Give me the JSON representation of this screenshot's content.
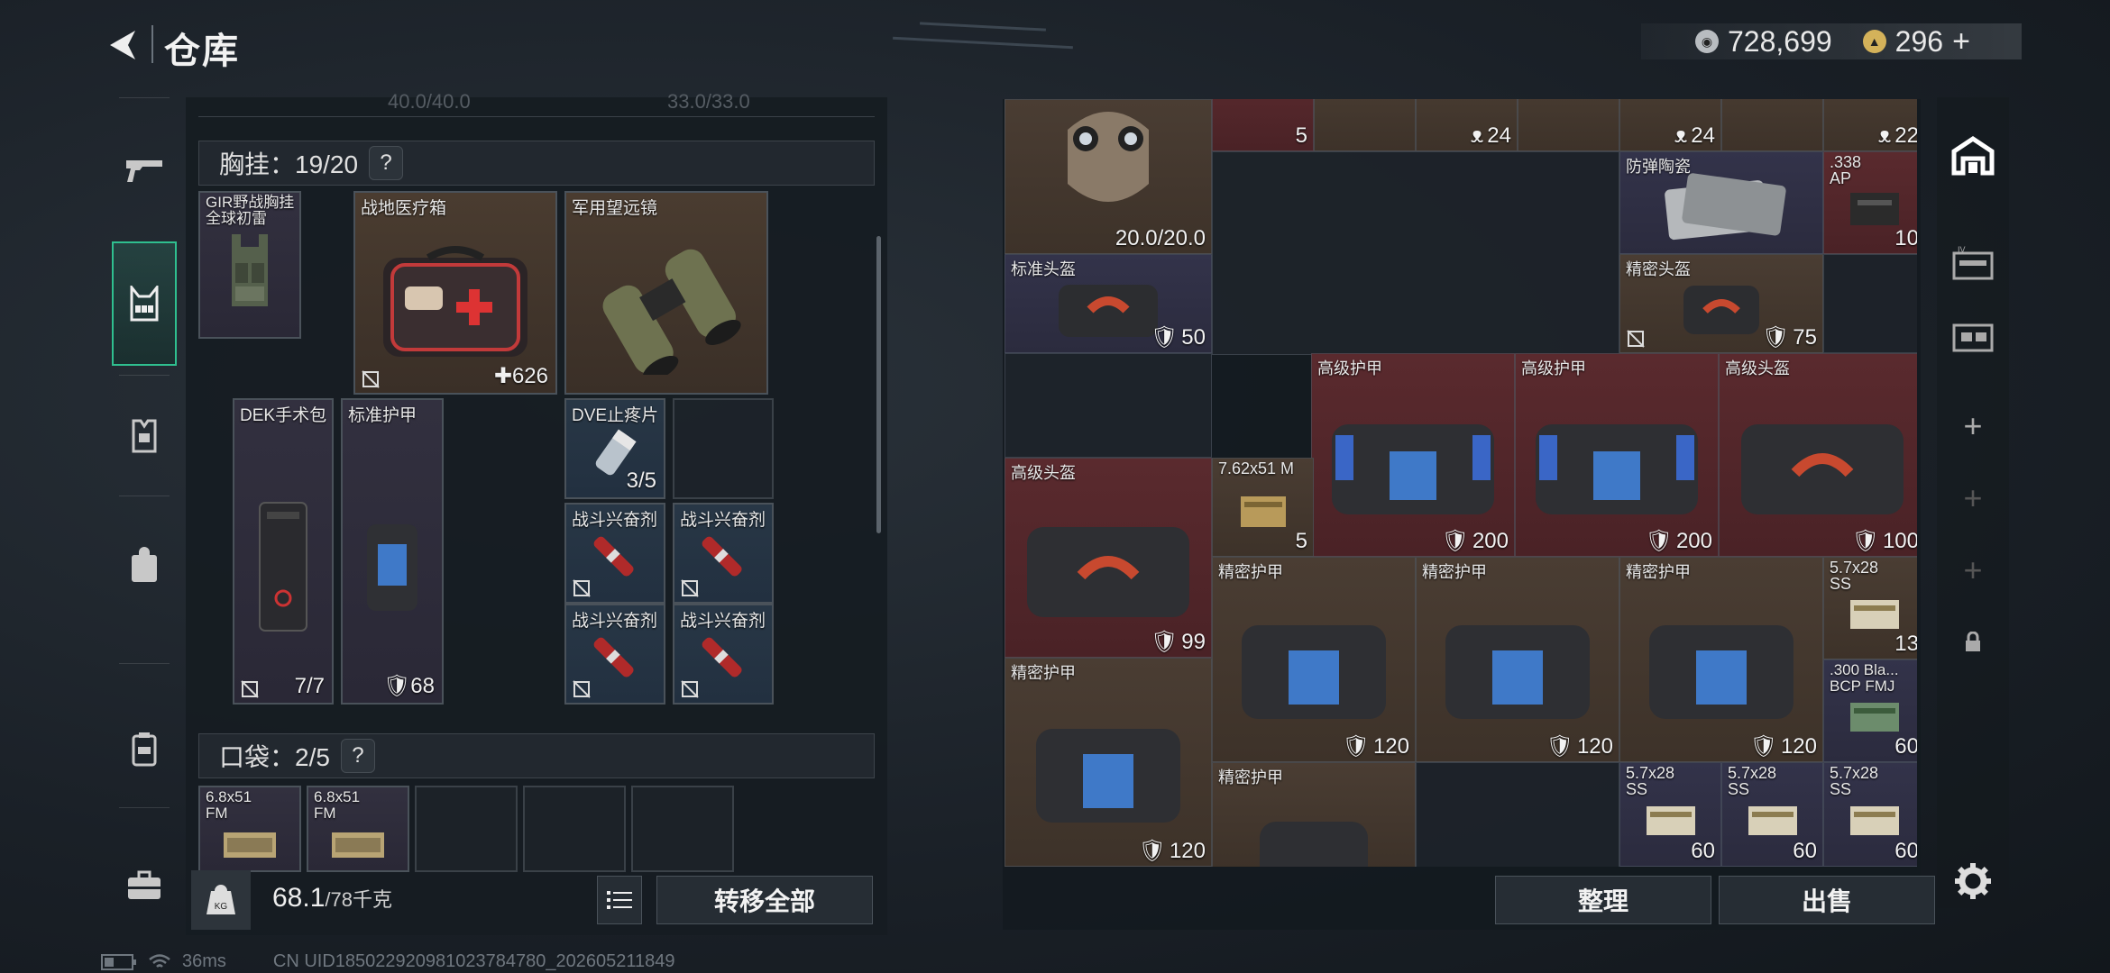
{
  "header": {
    "title": "仓库",
    "silver": "728,699",
    "gold": "296",
    "add_symbol": "+"
  },
  "left_panel": {
    "top_stats": {
      "left": "40.0/40.0",
      "right": "33.0/33.0"
    },
    "vest_section": {
      "label": "胸挂：19/20",
      "help": "?"
    },
    "vest_item": {
      "name": "GIR野战胸挂全球初雷"
    },
    "vest_slots": [
      {
        "name": "战地医疗箱",
        "value": "626",
        "icon": "plus-icon"
      },
      {
        "name": "军用望远镜",
        "value": ""
      },
      {
        "name": "DEK手术包",
        "value": "7/7",
        "icon": "no-insure-icon"
      },
      {
        "name": "标准护甲",
        "value": "68",
        "icon": "shield-icon"
      },
      {
        "name": "DVE止疼片",
        "value": "3/5"
      },
      {
        "name": "",
        "value": ""
      },
      {
        "name": "战斗兴奋剂",
        "value": ""
      },
      {
        "name": "战斗兴奋剂",
        "value": ""
      },
      {
        "name": "战斗兴奋剂",
        "value": ""
      },
      {
        "name": "战斗兴奋剂",
        "value": ""
      }
    ],
    "pocket_section": {
      "label": "口袋：2/5",
      "help": "?"
    },
    "pocket_items": [
      {
        "name": "6.8x51 FM"
      },
      {
        "name": "6.8x51 FM"
      },
      {
        "name": ""
      },
      {
        "name": ""
      },
      {
        "name": ""
      }
    ],
    "weight": {
      "current": "68.1",
      "max": "/78千克"
    },
    "transfer_all": "转移全部"
  },
  "stash": {
    "items": [
      {
        "id": "nvg",
        "name": "",
        "value": "20.0/20.0"
      },
      {
        "id": "top1",
        "name": "",
        "value": "5"
      },
      {
        "id": "top2",
        "name": "",
        "value": "24"
      },
      {
        "id": "top3",
        "name": "",
        "value": "24"
      },
      {
        "id": "top4",
        "name": "",
        "value": "22"
      },
      {
        "id": "plate",
        "name": "防弹陶瓷",
        "value": ""
      },
      {
        "id": "ap338",
        "name": ".338 AP",
        "value": "10"
      },
      {
        "id": "helm-std",
        "name": "标准头盔",
        "value": "50"
      },
      {
        "id": "helm-prec",
        "name": "精密头盔",
        "value": "75"
      },
      {
        "id": "armor-adv1",
        "name": "高级护甲",
        "value": "200"
      },
      {
        "id": "armor-adv2",
        "name": "高级护甲",
        "value": "200"
      },
      {
        "id": "helm-adv1",
        "name": "高级头盔",
        "value": "100"
      },
      {
        "id": "helm-adv2",
        "name": "高级头盔",
        "value": "99"
      },
      {
        "id": "ammo762",
        "name": "7.62x51 M",
        "value": "5"
      },
      {
        "id": "armor-prec1",
        "name": "精密护甲",
        "value": "120"
      },
      {
        "id": "armor-prec2",
        "name": "精密护甲",
        "value": "120"
      },
      {
        "id": "armor-prec3",
        "name": "精密护甲",
        "value": "120"
      },
      {
        "id": "ss190a",
        "name": "5.7x28 SS",
        "value": "13"
      },
      {
        "id": "blk300",
        "name": ".300 Bla... BCP FMJ",
        "value": "60"
      },
      {
        "id": "armor-prec4",
        "name": "精密护甲",
        "value": "120"
      },
      {
        "id": "armor-prec5",
        "name": "精密护甲",
        "value": ""
      },
      {
        "id": "ss190b",
        "name": "5.7x28 SS",
        "value": "60"
      },
      {
        "id": "ss190c",
        "name": "5.7x28 SS",
        "value": "60"
      },
      {
        "id": "ss190d",
        "name": "5.7x28 SS",
        "value": "60"
      }
    ],
    "sort": "整理",
    "sell": "出售"
  },
  "status_bar": {
    "ping": "36ms",
    "uid": "CN UID185022920981023784780_202605211849"
  },
  "colors": {
    "accent": "#2fbf8f",
    "red_cell": "#5a2a2e",
    "brown_cell": "#4a3d33",
    "purple_cell": "#33334a"
  }
}
